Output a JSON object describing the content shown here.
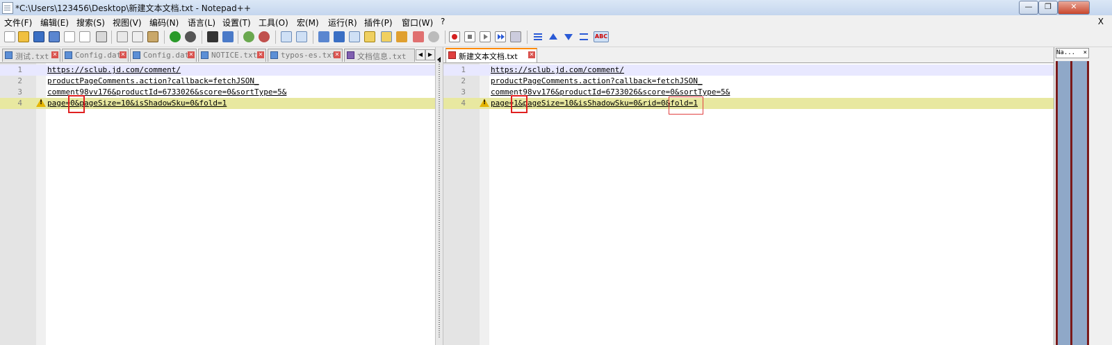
{
  "window": {
    "title": "*C:\\Users\\123456\\Desktop\\新建文本文档.txt - Notepad++",
    "controls": [
      "—",
      "❐",
      "✕"
    ]
  },
  "menu": {
    "items": [
      "文件(F)",
      "编辑(E)",
      "搜索(S)",
      "视图(V)",
      "编码(N)",
      "语言(L)",
      "设置(T)",
      "工具(O)",
      "宏(M)",
      "运行(R)",
      "插件(P)",
      "窗口(W)",
      "?"
    ],
    "close": "X"
  },
  "toolbar": {
    "icons": [
      "new-file-icon",
      "open-file-icon",
      "save-icon",
      "save-all-icon",
      "close-icon",
      "close-all-icon",
      "print-icon",
      "cut-icon",
      "copy-icon",
      "paste-icon",
      "undo-icon",
      "redo-icon",
      "find-icon",
      "replace-icon",
      "zoom-in-icon",
      "zoom-out-icon",
      "sync-vertical-icon",
      "sync-horizontal-icon",
      "word-wrap-icon",
      "show-all-chars-icon",
      "indent-guide-icon",
      "doc-map-icon",
      "function-list-icon",
      "folder-workspace-icon",
      "monitor-icon",
      "record-macro-icon",
      "stop-macro-icon",
      "play-macro-icon",
      "run-macro-multiple-icon",
      "save-macro-icon",
      "compare-icon",
      "prev-diff-icon",
      "next-diff-icon",
      "last-diff-icon",
      "spellcheck-icon"
    ],
    "spellcheck_label": "ABC",
    "colors": {
      "record": "#d42020",
      "blue_arrow": "#2a5ad6",
      "green": "#2a9a2a"
    }
  },
  "left_pane": {
    "tabs": [
      {
        "label": "测试.txt",
        "icon": "document-blue-icon"
      },
      {
        "label": "Config.dat",
        "icon": "document-blue-icon"
      },
      {
        "label": "Config.dat",
        "icon": "document-blue-icon"
      },
      {
        "label": "NOTICE.txt",
        "icon": "document-blue-icon"
      },
      {
        "label": "typos-es.txt",
        "icon": "document-blue-icon"
      },
      {
        "label": "文档信息.txt",
        "icon": "document-blue-icon"
      }
    ],
    "lines": [
      {
        "n": "1",
        "text": "https://sclub.jd.com/comment/"
      },
      {
        "n": "2",
        "text": "productPageComments.action?callback=fetchJSON_"
      },
      {
        "n": "3",
        "text": "comment98vv176&productId=6733026&score=0&sortType=5&"
      },
      {
        "n": "4",
        "text": "page=0&pageSize=10&isShadowSku=0&fold=1"
      }
    ]
  },
  "right_pane": {
    "tabs": [
      {
        "label": "新建文本文档.txt",
        "icon": "document-red-icon"
      }
    ],
    "lines": [
      {
        "n": "1",
        "text": "https://sclub.jd.com/comment/"
      },
      {
        "n": "2",
        "text": "productPageComments.action?callback=fetchJSON_"
      },
      {
        "n": "3",
        "text": "comment98vv176&productId=6733026&score=0&sortType=5&"
      },
      {
        "n": "4",
        "text": "page=1&pageSize=10&isShadowSku=0&rid=0&fold=1"
      }
    ]
  },
  "doc_map": {
    "header": "Na...",
    "close": "×"
  }
}
